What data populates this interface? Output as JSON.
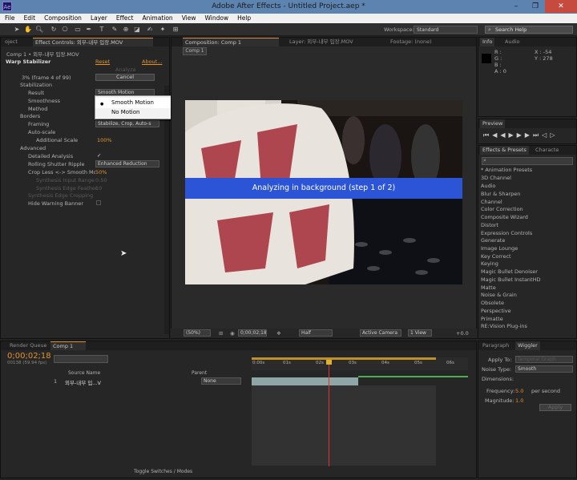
{
  "window": {
    "title": "Adobe After Effects - Untitled Project.aep *",
    "app_icon_text": "Ae",
    "controls": {
      "minimize": "–",
      "maximize": "❐",
      "close": "✕"
    }
  },
  "menu": [
    "File",
    "Edit",
    "Composition",
    "Layer",
    "Effect",
    "Animation",
    "View",
    "Window",
    "Help"
  ],
  "toolbar": {
    "workspace_label": "Workspace:",
    "workspace_value": "Standard",
    "search_placeholder": "Search Help"
  },
  "effect_controls": {
    "tab_project": "oject",
    "tab_label": "Effect Controls: 외부-내부 입장.MOV",
    "breadcrumb": "Comp 1 • 외부-내부 입장.MOV",
    "effect_name": "Warp Stabilizer",
    "reset": "Reset",
    "about": "About...",
    "analyze": "Analyze",
    "progress": "3% (frame 4 of 99)",
    "cancel": "Cancel",
    "stabilization": "Stabilization",
    "result_label": "Result",
    "result_value": "Smooth Motion",
    "smoothness_label": "Smoothness",
    "method_label": "Method",
    "borders": "Borders",
    "framing_label": "Framing",
    "framing_value": "Stabilize, Crop, Auto-s",
    "auto_scale": "Auto-scale",
    "additional_scale_label": "Additional Scale",
    "additional_scale_value": "100%",
    "advanced": "Advanced",
    "detailed_analysis": "Detailed Analysis",
    "rolling_shutter_label": "Rolling Shutter Ripple",
    "rolling_shutter_value": "Enhanced Reduction",
    "crop_less_label": "Crop Less <-> Smooth More",
    "crop_less_value": "50%",
    "synth_input_label": "Synthesis Input Range (seco",
    "synth_input_value": "0.50",
    "synth_edge_feather_label": "Synthesis Edge Feather",
    "synth_edge_feather_value": "10",
    "synth_edge_cropping": "Synthesis Edge Cropping",
    "hide_warning": "Hide Warning Banner",
    "menu_options": [
      "Smooth Motion",
      "No Motion"
    ]
  },
  "composition": {
    "tab_label": "Composition: Comp 1",
    "layer_tab": "Layer: 외부-내부 입장.MOV",
    "footage_tab": "Footage: (none)",
    "comp_tab": "Comp 1",
    "banner": "Analyzing in background (step 1 of 2)",
    "overlay_text": " ",
    "zoom": "(50%)",
    "timecode": "0;00;02;18",
    "resolution": "Half",
    "camera": "Active Camera",
    "views": "1 View",
    "offset": "+0.0"
  },
  "info": {
    "tab_info": "Info",
    "tab_audio": "Audio",
    "r": "R :",
    "g": "G :",
    "b": "B :",
    "a": "A : 0",
    "x": "X : -54",
    "y": "Y : 278"
  },
  "preview": {
    "tab": "Preview"
  },
  "effects_presets": {
    "tab": "Effects & Presets",
    "tab_character": "Characte",
    "search_placeholder": "",
    "items": [
      "* Animation Presets",
      "3D Channel",
      "Audio",
      "Blur & Sharpen",
      "Channel",
      "Color Correction",
      "Composite Wizard",
      "Distort",
      "Expression Controls",
      "Generate",
      "Image Lounge",
      "Key Correct",
      "Keying",
      "Magic Bullet Denoiser",
      "Magic Bullet InstantHD",
      "Matte",
      "Noise & Grain",
      "Obsolete",
      "Perspective",
      "Primatte",
      "RE:Vision Plug-ins"
    ]
  },
  "timeline": {
    "tab_render": "Render Queue",
    "tab_comp": "Comp 1",
    "timecode": "0;00;02;18",
    "fps": "00138 (59.94 fps)",
    "col_source": "Source Name",
    "col_parent": "Parent",
    "layer_num": "1",
    "layer_name": "외부-내부 입...V",
    "parent_value": "None",
    "ruler": [
      "0:00s",
      "01s",
      "02s",
      "03s",
      "04s",
      "05s",
      "06s"
    ],
    "toggle": "Toggle Switches / Modes"
  },
  "wiggler": {
    "tab_paragraph": "Paragraph",
    "tab_wiggler": "Wiggler",
    "apply_to_label": "Apply To:",
    "apply_to_value": "Temporal Graph",
    "noise_type_label": "Noise Type:",
    "noise_type_value": "Smooth",
    "dimensions_label": "Dimensions:",
    "frequency_label": "Frequency:",
    "frequency_value": "5.0",
    "per_second": "per second",
    "magnitude_label": "Magnitude:",
    "magnitude_value": "1.0",
    "apply": "Apply"
  }
}
